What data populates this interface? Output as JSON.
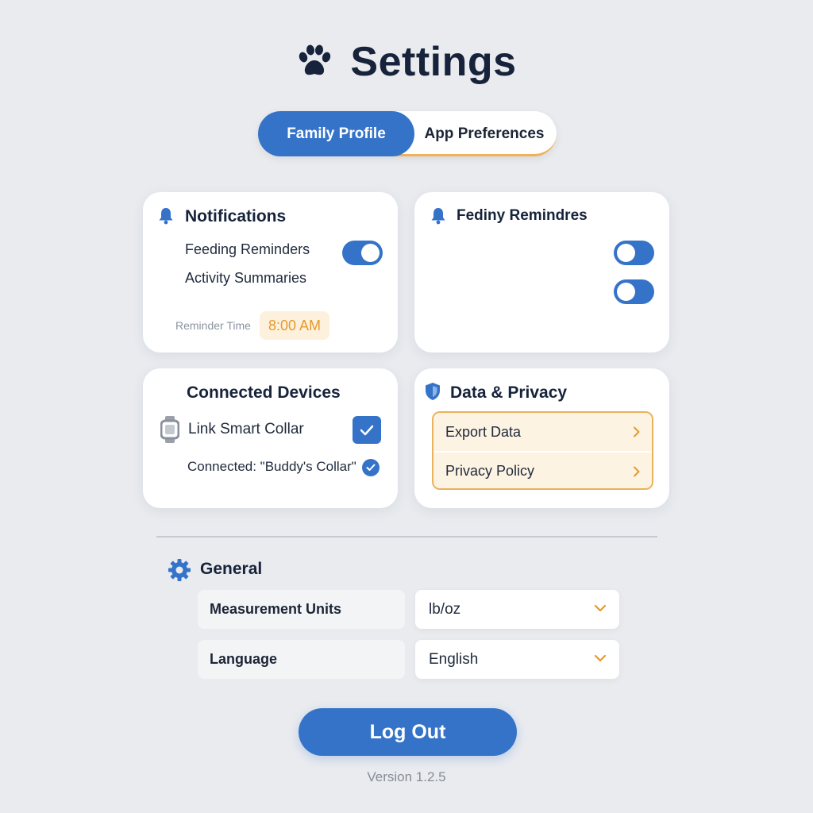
{
  "header": {
    "title": "Settings",
    "icon": "paw-icon"
  },
  "tabs": [
    {
      "label": "Family Profile",
      "active": true
    },
    {
      "label": "App Preferences",
      "active": false
    }
  ],
  "notifications": {
    "title": "Notifications",
    "items": [
      {
        "label": "Feeding Reminders",
        "toggle": true
      },
      {
        "label": "Activity Summaries"
      }
    ],
    "reminder_time_label": "Reminder Time",
    "reminder_time_value": "8:00 AM"
  },
  "feeding_card": {
    "title": "Fediny Remindres",
    "toggles": [
      false,
      false
    ]
  },
  "devices": {
    "title": "Connected Devices",
    "link_label": "Link Smart Collar",
    "link_checked": true,
    "connected_text": "Connected: \"Buddy's Collar\""
  },
  "privacy": {
    "title": "Data & Privacy",
    "items": [
      {
        "label": "Export Data"
      },
      {
        "label": "Privacy Policy"
      }
    ]
  },
  "general": {
    "title": "General",
    "settings": [
      {
        "label": "Measurement Units",
        "value": "lb/oz"
      },
      {
        "label": "Language",
        "value": "English"
      }
    ]
  },
  "logout_label": "Log Out",
  "version": "Version 1.2.5",
  "colors": {
    "primary": "#3573c9",
    "accent": "#e59a2b",
    "background": "#e9ebef",
    "title": "#16233a"
  }
}
